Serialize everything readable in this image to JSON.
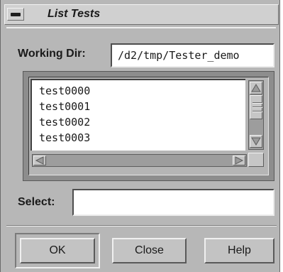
{
  "window": {
    "title": "List Tests"
  },
  "working_dir": {
    "label": "Working Dir:",
    "value": "/d2/tmp/Tester_demo"
  },
  "test_list": {
    "items": [
      "test0000",
      "test0001",
      "test0002",
      "test0003"
    ]
  },
  "select": {
    "label": "Select:",
    "value": ""
  },
  "buttons": {
    "ok": "OK",
    "close": "Close",
    "help": "Help"
  },
  "colors": {
    "dialog_bg": "#b7b7b7",
    "field_bg": "#ffffff"
  },
  "icons": {
    "window_menu": "window-menu-icon",
    "scroll_up": "up-arrow-icon",
    "scroll_down": "down-arrow-icon",
    "scroll_left": "left-arrow-icon",
    "scroll_right": "right-arrow-icon"
  }
}
